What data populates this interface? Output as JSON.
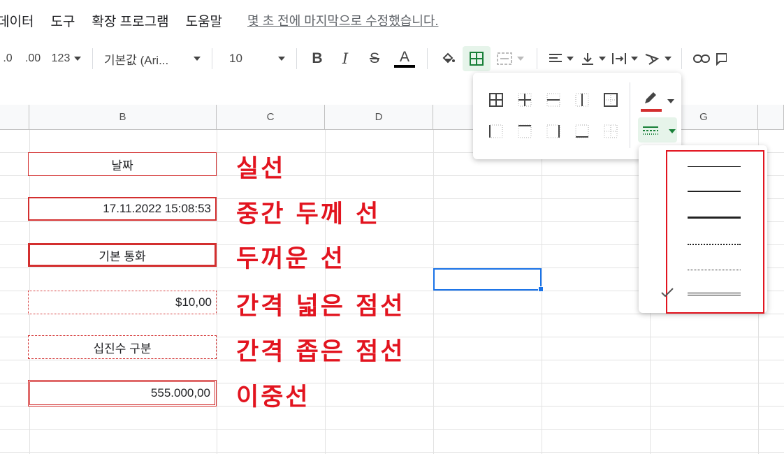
{
  "menubar": {
    "items": [
      "데이터",
      "도구",
      "확장 프로그램",
      "도움말"
    ],
    "last_edit": "몇 초 전에 마지막으로 수정했습니다."
  },
  "toolbar": {
    "decimal_decrease": ".0",
    "decimal_increase": ".00",
    "number_format": "123",
    "font_family": "기본값 (Ari...",
    "font_size": "10",
    "bold": "B",
    "italic": "I",
    "strikethrough": "S",
    "text_color": "A",
    "text_color_hex": "#000000"
  },
  "columns": [
    "B",
    "C",
    "D",
    "G"
  ],
  "cells": [
    {
      "value": "날짜",
      "label": "실선"
    },
    {
      "value": "17.11.2022 15:08:53",
      "label": "중간 두께 선"
    },
    {
      "value": "기본 통화",
      "label": "두꺼운 선"
    },
    {
      "value": "$10,00",
      "label": "간격 넓은 점선"
    },
    {
      "value": "십진수 구분",
      "label": "간격 좁은 점선"
    },
    {
      "value": "555.000,00",
      "label": "이중선"
    }
  ],
  "border_panel": {
    "border_color_hex": "#d32f2f",
    "border_style_hex": "#188038",
    "icons": [
      "all-borders-icon",
      "inner-borders-icon",
      "horizontal-borders-icon",
      "vertical-borders-icon",
      "outer-borders-icon",
      "left-border-icon",
      "top-border-icon",
      "right-border-icon",
      "bottom-border-icon",
      "clear-borders-icon"
    ]
  },
  "line_styles": {
    "options": [
      "solid-thin",
      "solid-medium",
      "solid-thick",
      "dotted",
      "dashed",
      "double"
    ],
    "selected": "double"
  },
  "colors": {
    "accent_red": "#e2141f",
    "selection_blue": "#1a73e8"
  }
}
